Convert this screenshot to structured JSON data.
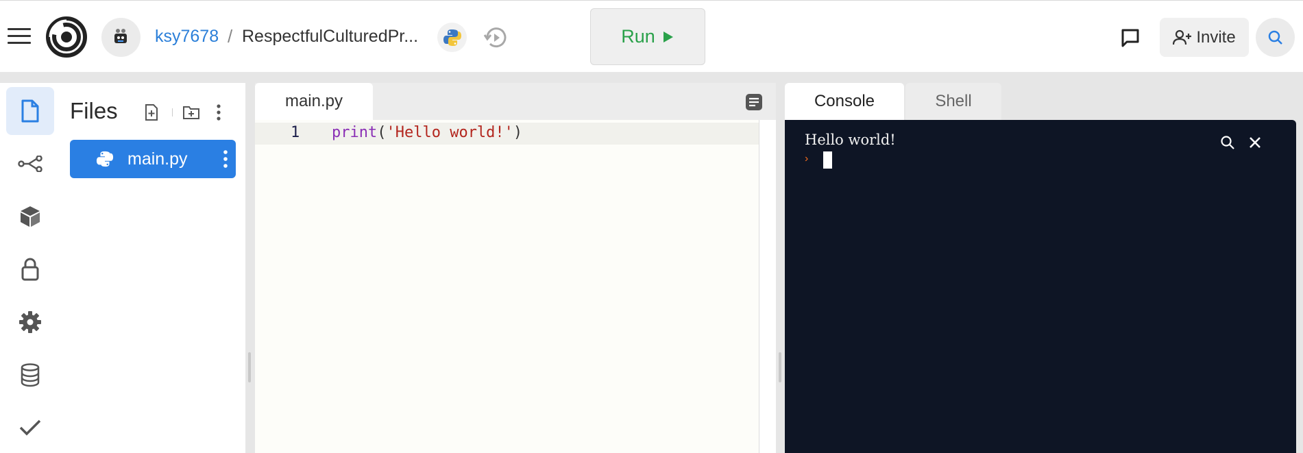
{
  "header": {
    "user": "ksy7678",
    "separator": "/",
    "repl_name": "RespectfulCulturedPr...",
    "run_label": "Run",
    "invite_label": "Invite"
  },
  "activity_bar": {
    "items": [
      "files-icon",
      "git-icon",
      "packages-icon",
      "secrets-icon",
      "settings-icon",
      "database-icon",
      "check-icon"
    ],
    "active": "files-icon"
  },
  "files": {
    "title": "Files",
    "items": [
      {
        "label": "main.py",
        "selected": true
      }
    ]
  },
  "editor": {
    "tab_label": "main.py",
    "lines": [
      {
        "number": "1",
        "fn": "print",
        "open": "(",
        "str": "'Hello world!'",
        "close": ")"
      }
    ]
  },
  "console": {
    "tabs": [
      "Console",
      "Shell"
    ],
    "active_tab": "Console",
    "output": "Hello world!",
    "prompt": "›"
  },
  "colors": {
    "accent": "#2a7fe3",
    "run_green": "#2aa14a",
    "console_bg": "#0e1525",
    "prompt_orange": "#f26b1d"
  }
}
